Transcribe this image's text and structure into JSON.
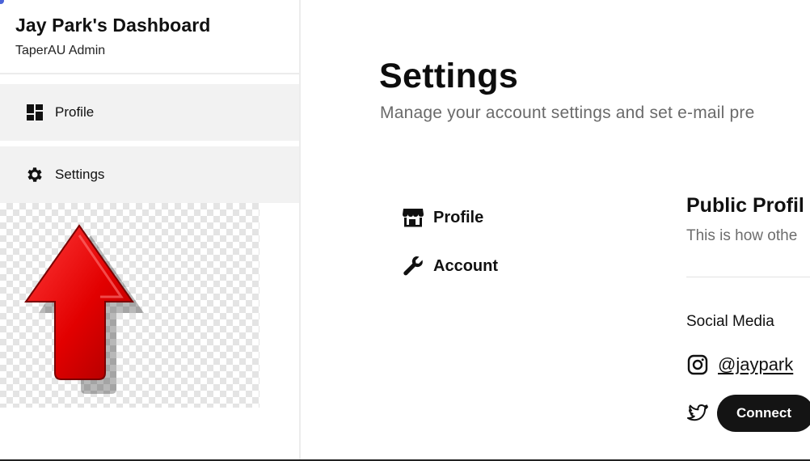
{
  "sidebar": {
    "title": "Jay Park's Dashboard",
    "subtitle": "TaperAU Admin",
    "items": [
      {
        "label": "Profile",
        "icon": "dashboard-grid-icon"
      },
      {
        "label": "Settings",
        "icon": "gear-icon"
      }
    ]
  },
  "main": {
    "title": "Settings",
    "description": "Manage your account settings and set e-mail pre",
    "subnav": [
      {
        "label": "Profile",
        "icon": "store-icon"
      },
      {
        "label": "Account",
        "icon": "wrench-icon"
      }
    ],
    "section": {
      "title": "Public Profil",
      "description": "This is how othe"
    },
    "social": {
      "heading": "Social Media",
      "instagram_handle": "@jaypark",
      "twitter_button": "Connect"
    }
  },
  "colors": {
    "accent": "#4a63d8",
    "arrow_red": "#e00000",
    "button_bg": "#141414"
  }
}
